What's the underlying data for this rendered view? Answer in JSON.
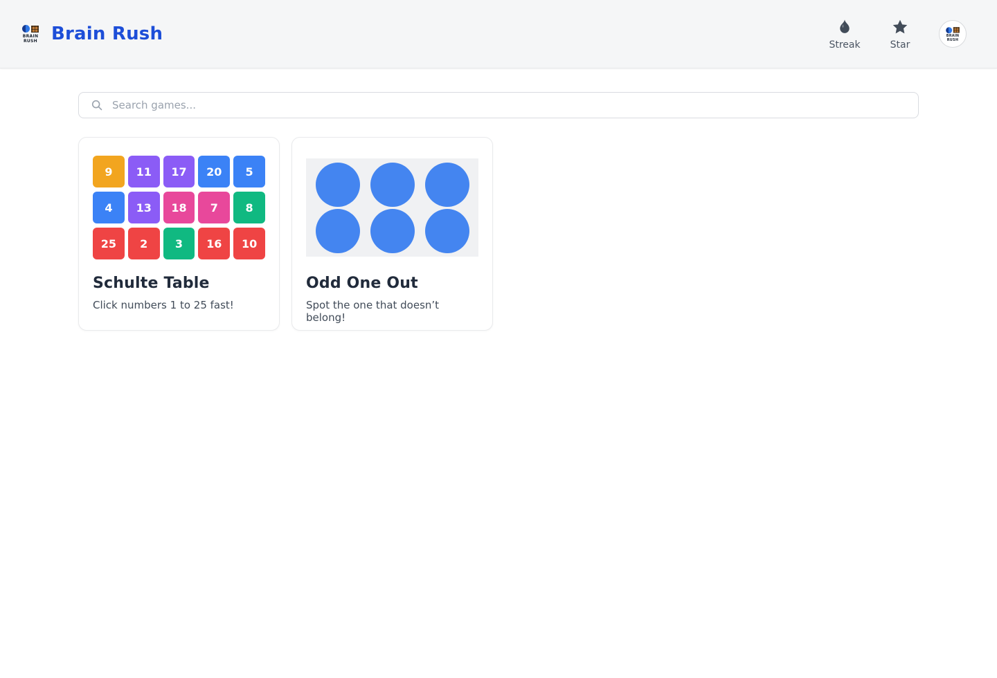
{
  "header": {
    "app_title": "Brain Rush",
    "logo": {
      "line1": "BRAIN",
      "line2": "RUSH"
    },
    "nav": [
      {
        "id": "streak",
        "label": "Streak",
        "icon": "droplet-flame-icon"
      },
      {
        "id": "star",
        "label": "Star",
        "icon": "star-icon"
      }
    ],
    "avatar": {
      "line1": "BRAIN",
      "line2": "RUSH"
    }
  },
  "search": {
    "placeholder": "Search games...",
    "icon": "search-icon",
    "value": ""
  },
  "cards": [
    {
      "id": "schulte-table",
      "title": "Schulte Table",
      "subtitle": "Click numbers 1 to 25 fast!",
      "preview": {
        "type": "number-grid",
        "columns": 5,
        "tiles": [
          {
            "label": "9",
            "color": "#f2a51f"
          },
          {
            "label": "11",
            "color": "#8b5cf6"
          },
          {
            "label": "17",
            "color": "#8b5cf6"
          },
          {
            "label": "20",
            "color": "#3b82f6"
          },
          {
            "label": "5",
            "color": "#3b82f6"
          },
          {
            "label": "4",
            "color": "#3b82f6"
          },
          {
            "label": "13",
            "color": "#8b5cf6"
          },
          {
            "label": "18",
            "color": "#e8489b"
          },
          {
            "label": "7",
            "color": "#e8489b"
          },
          {
            "label": "8",
            "color": "#10b981"
          },
          {
            "label": "25",
            "color": "#ef4444"
          },
          {
            "label": "2",
            "color": "#ef4444"
          },
          {
            "label": "3",
            "color": "#10b981"
          },
          {
            "label": "16",
            "color": "#ef4444"
          },
          {
            "label": "10",
            "color": "#ef4444"
          }
        ]
      }
    },
    {
      "id": "odd-one-out",
      "title": "Odd One Out",
      "subtitle": "Spot the one that doesn’t belong!",
      "preview": {
        "type": "circle-grid",
        "rows": 2,
        "columns": 3,
        "count": 6,
        "circle_color": "#4485f0",
        "background": "#f0f1f3"
      }
    }
  ],
  "colors": {
    "accent_blue": "#1d4ed8",
    "header_bg": "#f5f6f7",
    "icon_gray": "#424c59",
    "tile_orange": "#f2a51f",
    "tile_purple": "#8b5cf6",
    "tile_blue": "#3b82f6",
    "tile_pink": "#e8489b",
    "tile_green": "#10b981",
    "tile_red": "#ef4444"
  }
}
